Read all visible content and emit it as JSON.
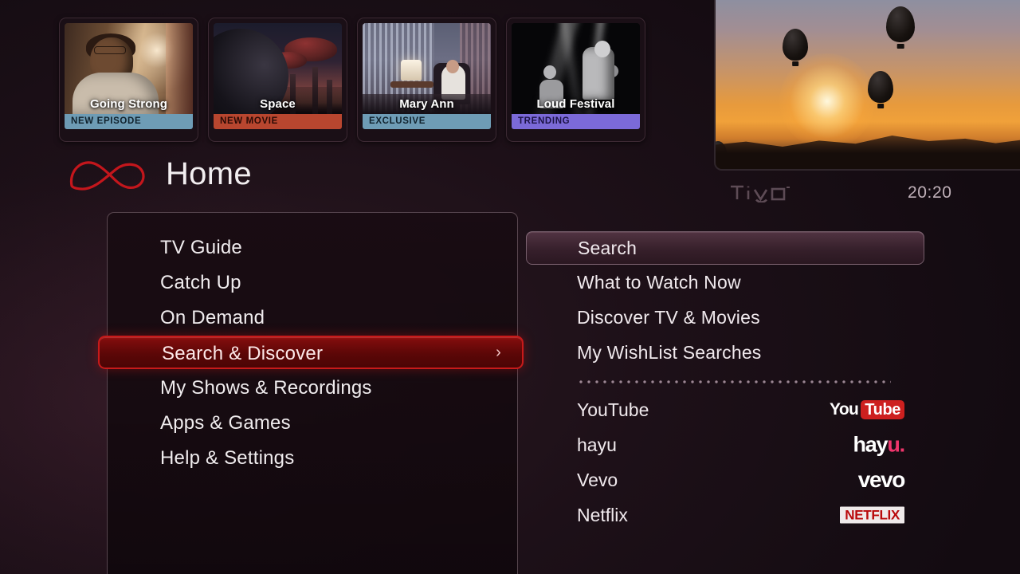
{
  "header": {
    "page_title": "Home",
    "logo_icon": "tivo-infinity-logo",
    "brand_wordmark": "TiVo",
    "clock": "20:20"
  },
  "carousel": {
    "tiles": [
      {
        "title": "Going Strong",
        "badge": "NEW EPISODE",
        "badge_color": "#6e9cb5",
        "badge_text_color": "#10222d",
        "art": "man-at-window"
      },
      {
        "title": "Space",
        "badge": "NEW MOVIE",
        "badge_color": "#b8462f",
        "badge_text_color": "#2a0a05",
        "art": "sci-fi-city"
      },
      {
        "title": "Mary Ann",
        "badge": "EXCLUSIVE",
        "badge_color": "#6e9cb5",
        "badge_text_color": "#10222d",
        "art": "woman-in-room"
      },
      {
        "title": "Loud Festival",
        "badge": "TRENDING",
        "badge_color": "#7b6ad8",
        "badge_text_color": "#1c1346",
        "art": "concert-bw"
      }
    ]
  },
  "preview": {
    "scene": "hot-air-balloons-at-sunset"
  },
  "main_menu": {
    "items": [
      {
        "label": "TV Guide",
        "selected": false
      },
      {
        "label": "Catch Up",
        "selected": false
      },
      {
        "label": "On Demand",
        "selected": false
      },
      {
        "label": "Search & Discover",
        "selected": true,
        "chevron": "›"
      },
      {
        "label": "My Shows & Recordings",
        "selected": false
      },
      {
        "label": "Apps & Games",
        "selected": false
      },
      {
        "label": "Help & Settings",
        "selected": false
      }
    ]
  },
  "submenu": {
    "items": [
      {
        "label": "Search",
        "highlighted": true
      },
      {
        "label": "What to Watch Now",
        "highlighted": false
      },
      {
        "label": "Discover TV & Movies",
        "highlighted": false
      },
      {
        "label": "My WishList Searches",
        "highlighted": false
      }
    ],
    "apps": [
      {
        "label": "YouTube",
        "logo": "youtube-logo",
        "logo_parts": {
          "a": "You",
          "b": "Tube"
        }
      },
      {
        "label": "hayu",
        "logo": "hayu-logo",
        "logo_parts": {
          "a": "hay",
          "b": "u."
        }
      },
      {
        "label": "Vevo",
        "logo": "vevo-logo",
        "logo_parts": {
          "a": "vevo",
          "b": ""
        }
      },
      {
        "label": "Netflix",
        "logo": "netflix-logo",
        "logo_parts": {
          "a": "NETFLIX",
          "b": ""
        }
      }
    ]
  },
  "colors": {
    "accent_red": "#c81a1a",
    "background": "#1d1018",
    "text": "#f0ecee"
  }
}
